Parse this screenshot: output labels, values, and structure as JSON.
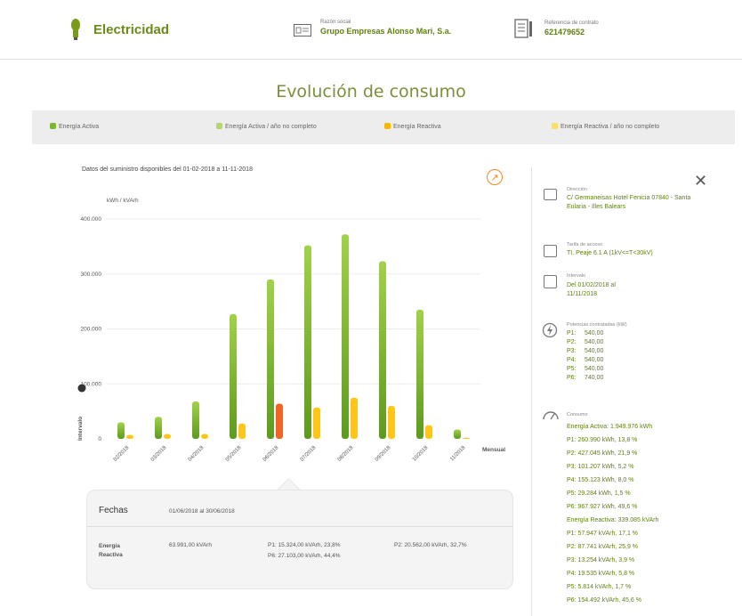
{
  "header": {
    "brand": "Electricidad",
    "razon_label": "Razón social",
    "razon_value": "Grupo Empresas Alonso Mari, S.a.",
    "ref_label": "Referencia de contrato",
    "ref_value": "621479652"
  },
  "page_title": "Evolución de consumo",
  "legend": [
    {
      "label": "Energía Activa",
      "color": "#7cb82f"
    },
    {
      "label": "Energía Activa / año no completo",
      "color": "#b5d66a"
    },
    {
      "label": "Energía Reactiva",
      "color": "#f5b800"
    },
    {
      "label": "Energía Reactiva / año no completo",
      "color": "#fbdc6c"
    }
  ],
  "chart_title": "Datos del suministro disponibles del 01-02-2018 a 11-11-2018",
  "chart_data": {
    "type": "bar",
    "ylabel": "kWh / kVArh",
    "xlabel": "Mensual",
    "side_label": "Intervalo",
    "ylim": [
      0,
      400000
    ],
    "y_ticks": [
      "400.000",
      "300.000",
      "200.000",
      "100.000",
      "0"
    ],
    "y_tick_values": [
      400000,
      300000,
      200000,
      100000,
      0
    ],
    "categories": [
      "02/2018",
      "03/2018",
      "04/2018",
      "05/2018",
      "06/2018",
      "07/2018",
      "08/2018",
      "09/2018",
      "10/2018",
      "11/2018"
    ],
    "series": [
      {
        "name": "Energía Activa",
        "values": [
          30000,
          40000,
          68000,
          227000,
          290000,
          352000,
          372000,
          323000,
          235000,
          17000
        ]
      },
      {
        "name": "Energía Reactiva",
        "values": [
          7000,
          9000,
          9000,
          28000,
          63991,
          57000,
          75000,
          60000,
          25000,
          2000
        ]
      }
    ],
    "highlight_index": 4,
    "colors": {
      "activa_top": "#a2d14a",
      "activa_bottom": "#5d9a1e",
      "reactiva": "#ffc61a",
      "highlight": "#f06523"
    }
  },
  "tooltip": {
    "fechas_label": "Fechas",
    "fechas_value": "01/06/2018 al 30/06/2018",
    "energia_label": "Energía Reactiva",
    "total": "63.991,00 kVArh",
    "p1": "P1: 15.324,00 kVArh, 23,8%",
    "p2": "P2: 20.562,00 kVArh, 32,7%",
    "p6": "P6: 27.103,00 kVArh, 44,4%"
  },
  "panel": {
    "direccion_label": "Dirección",
    "direccion_value": "C/ Germaneisas Hotel Fenicia 07840 - Santa Eularia - Illes Balears",
    "tarifa_label": "Tarifa de acceso",
    "tarifa_value": "TI. Peaje 6.1 A (1kV<=T<30kV)",
    "intervalo_label": "Intervalo",
    "intervalo_value": "Del 01/02/2018 al 11/11/2018",
    "potencias_label": "Potencias contratadas (kW)",
    "potencias": [
      {
        "p": "P1:",
        "v": "540,00"
      },
      {
        "p": "P2:",
        "v": "540,00"
      },
      {
        "p": "P3:",
        "v": "540,00"
      },
      {
        "p": "P4:",
        "v": "540,00"
      },
      {
        "p": "P5:",
        "v": "540,00"
      },
      {
        "p": "P6:",
        "v": "740,00"
      }
    ],
    "consumo_label": "Consumo",
    "consumo_lines": [
      "Energía Activa: 1.949.976 kWh",
      "P1: 260.990 kWh, 13,8 %",
      "P2: 427.045 kWh, 21,9 %",
      "P3: 101.207 kWh, 5,2 %",
      "P4: 155.123 kWh, 8,0 %",
      "P5: 29.284 kWh, 1,5 %",
      "P6: 967.927 kWh, 49,6 %",
      "Energía Reactiva: 339.085 kVArh",
      "P1: 57.947 kVArh, 17,1 %",
      "P2: 87.741 kVArh, 25,9 %",
      "P3: 13.254 kVArh, 3,9 %",
      "P4: 19.535 kVArh, 5,8 %",
      "P5: 5.814 kVArh, 1,7 %",
      "P6: 154.492 kVArh, 45,6 %"
    ]
  }
}
